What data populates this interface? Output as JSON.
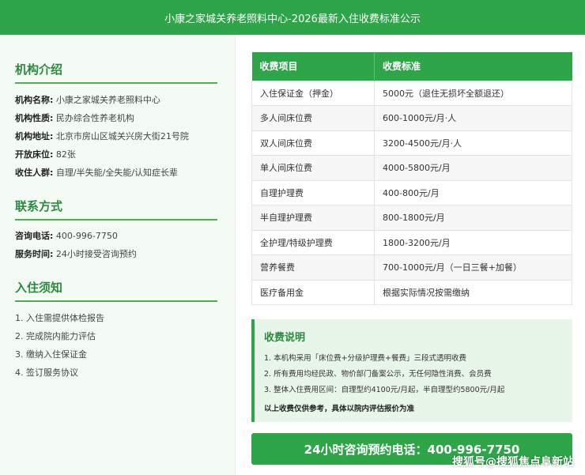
{
  "header": {
    "title": "小康之家城关养老照料中心-2026最新入住收费标准公示"
  },
  "sidebar": {
    "institution": {
      "title": "机构介绍",
      "rows": [
        {
          "key": "机构名称:",
          "value": "小康之家城关养老照料中心"
        },
        {
          "key": "机构性质:",
          "value": "民办综合性养老机构"
        },
        {
          "key": "机构地址:",
          "value": "北京市房山区城关兴房大街21号院"
        },
        {
          "key": "开放床位:",
          "value": "82张"
        },
        {
          "key": "收住人群:",
          "value": "自理/半失能/全失能/认知症长辈"
        }
      ]
    },
    "contact": {
      "title": "联系方式",
      "rows": [
        {
          "key": "咨询电话:",
          "value": "400-996-7750"
        },
        {
          "key": "服务时间:",
          "value": "24小时接受咨询预约"
        }
      ]
    },
    "admission": {
      "title": "入住须知",
      "items": [
        "1. 入住需提供体检报告",
        "2. 完成院内能力评估",
        "3. 缴纳入住保证金",
        "4. 签订服务协议"
      ]
    }
  },
  "fees": {
    "headers": [
      "收费项目",
      "收费标准"
    ],
    "rows": [
      [
        "入住保证金（押金）",
        "5000元（退住无损坏全额退还）"
      ],
      [
        "多人间床位费",
        "600-1000元/月·人"
      ],
      [
        "双人间床位费",
        "3200-4500元/月·人"
      ],
      [
        "单人间床位费",
        "4000-5800元/月"
      ],
      [
        "自理护理费",
        "400-800元/月"
      ],
      [
        "半自理护理费",
        "800-1800元/月"
      ],
      [
        "全护理/特级护理费",
        "1800-3200元/月"
      ],
      [
        "营养餐费",
        "700-1000元/月（一日三餐+加餐）"
      ],
      [
        "医疗备用金",
        "根据实际情况按需缴纳"
      ]
    ]
  },
  "notes": {
    "title": "收费说明",
    "lines": [
      "1. 本机构采用「床位费+分级护理费+餐费」三段式透明收费",
      "2. 所有费用均经民政、物价部门备案公示，无任何隐性消费、会员费",
      "3. 整体入住费用区间：自理型约4100元/月起，半自理型约5800元/月起"
    ],
    "bold": "以上收费仅供参考，具体以院内评估报价为准"
  },
  "cta": {
    "label": "24小时咨询预约电话：400-996-7750"
  },
  "watermark": {
    "text": "搜狐号@搜狐焦点阜新站"
  },
  "colors": {
    "brand_green": "#2fa54a",
    "title_green": "#2c8a3e",
    "note_bg": "#e8f5e9"
  }
}
